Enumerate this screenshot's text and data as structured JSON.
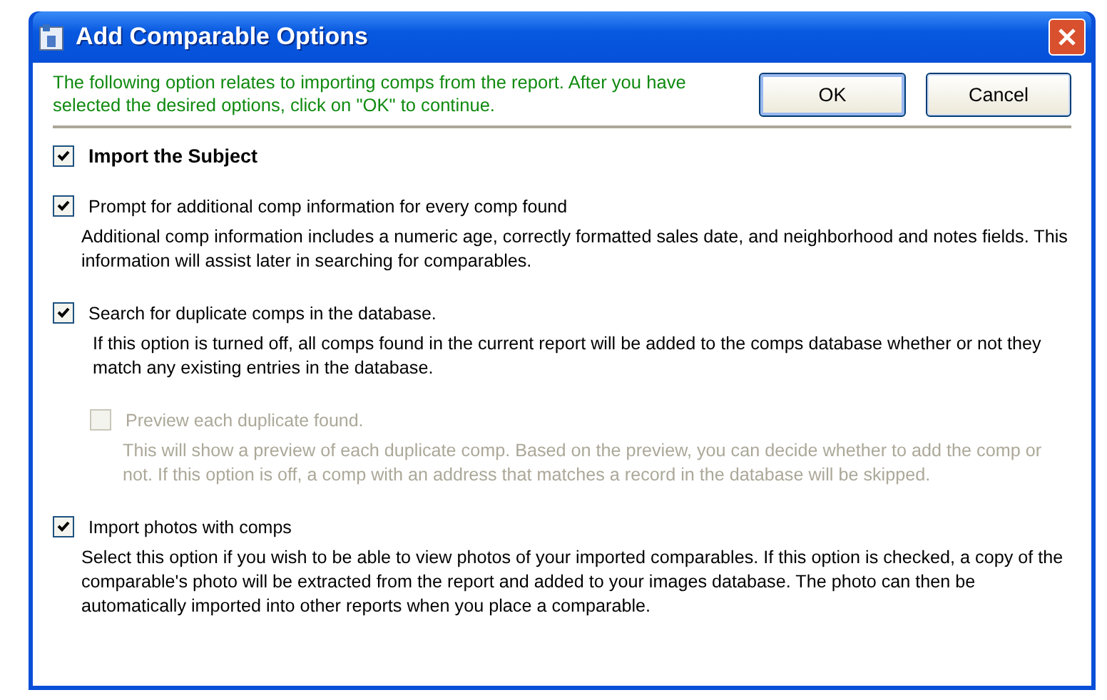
{
  "window": {
    "title": "Add Comparable Options"
  },
  "intro": "The following option relates to importing comps from the report.  After you have selected the desired options, click on \"OK\" to continue.",
  "buttons": [
    {
      "label": "OK",
      "default": true
    },
    {
      "label": "Cancel",
      "default": false
    }
  ],
  "options": [
    {
      "label": "Import the Subject",
      "bold": true,
      "checked": true,
      "disabled": false
    },
    {
      "label": "Prompt for additional comp information for every comp found",
      "bold": false,
      "checked": true,
      "disabled": false,
      "description": "Additional comp information includes a numeric age, correctly formatted sales date, and neighborhood and notes fields.  This information will assist later in searching for comparables."
    },
    {
      "label": "Search for duplicate comps in the database.",
      "bold": false,
      "checked": true,
      "disabled": false,
      "description": "If this option is turned off, all comps found in the current report will be added to the comps database whether or not they match any existing entries in the database.",
      "children": [
        {
          "label": "Preview each duplicate found.",
          "bold": false,
          "checked": false,
          "disabled": true,
          "description": "This will show a preview of each duplicate comp.  Based on the preview, you can decide whether to add the comp or not.  If this option is off, a comp with an address that matches a record in the database will be skipped."
        }
      ]
    },
    {
      "label": "Import photos with comps",
      "bold": false,
      "checked": true,
      "disabled": false,
      "description": "Select this option if you wish to be able to view photos of your imported comparables.  If this option is checked, a copy of the comparable's photo will be extracted from the report and added to your images database.  The photo can then be automatically imported into other reports when you place a comparable."
    }
  ]
}
